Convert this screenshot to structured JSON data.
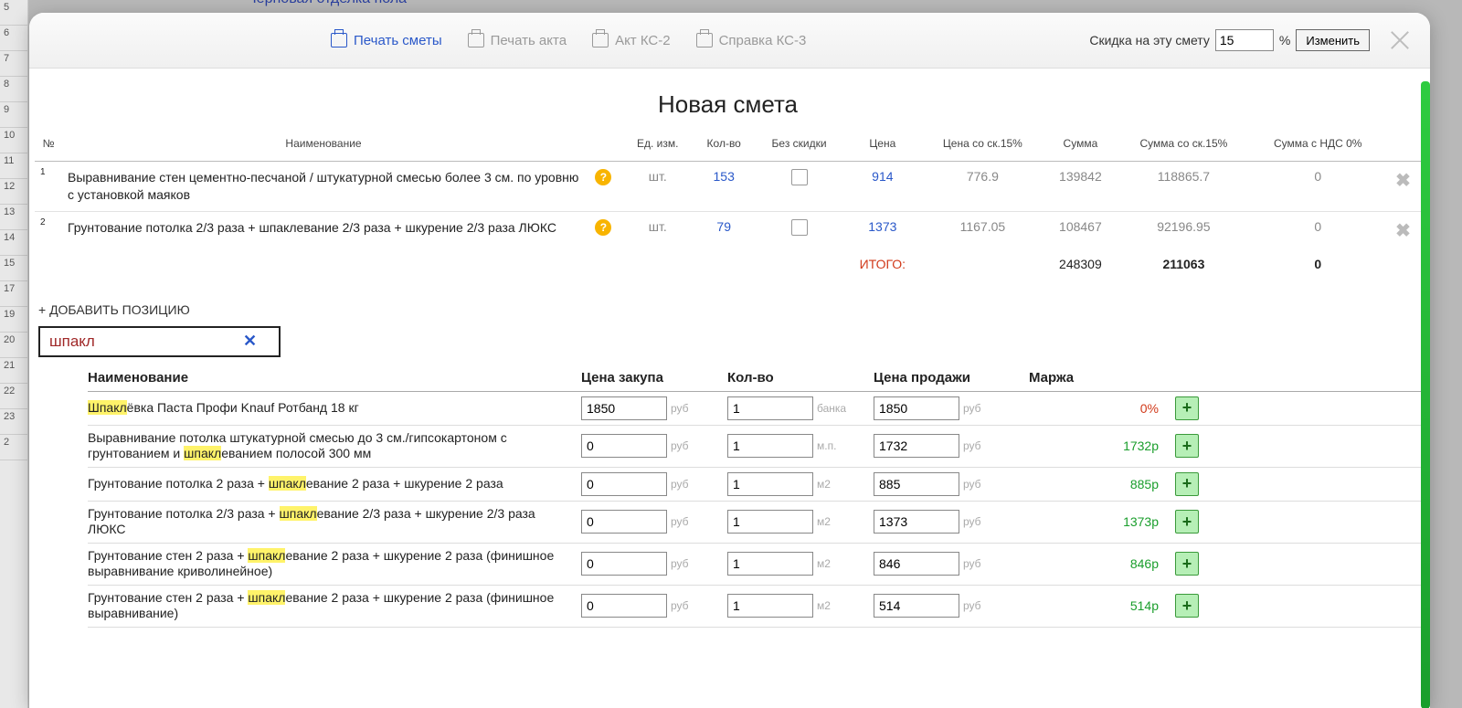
{
  "bg": {
    "header_text": "Черновая отделка пола",
    "row_numbers": [
      "5",
      "6",
      "7",
      "8",
      "9",
      "10",
      "11",
      "12",
      "13",
      "14",
      "15",
      "17",
      "19",
      "20",
      "21",
      "22",
      "23",
      "2"
    ]
  },
  "toolbar": {
    "print_estimate": "Печать сметы",
    "print_act": "Печать акта",
    "act_ks2": "Акт КС-2",
    "ref_ks3": "Справка КС-3",
    "discount_label": "Скидка на эту смету",
    "discount_value": "15",
    "discount_pct": "%",
    "apply": "Изменить"
  },
  "title": "Новая смета",
  "columns": {
    "num": "№",
    "name": "Наименование",
    "unit": "Ед. изм.",
    "qty": "Кол-во",
    "no_disc": "Без скидки",
    "price": "Цена",
    "price_disc": "Цена со ск.15%",
    "sum": "Сумма",
    "sum_disc": "Сумма со ск.15%",
    "sum_vat": "Сумма с НДС 0%"
  },
  "rows": [
    {
      "idx": "1",
      "name": "Выравнивание стен цементно-песчаной / штукатурной смесью более 3 см. по уровню с установкой маяков",
      "unit": "шт.",
      "qty": "153",
      "price": "914",
      "price_disc": "776.9",
      "sum": "139842",
      "sum_disc": "118865.7",
      "sum_vat": "0"
    },
    {
      "idx": "2",
      "name": "Грунтование потолка 2/3 раза + шпаклевание 2/3 раза + шкурение 2/3 раза ЛЮКС",
      "unit": "шт.",
      "qty": "79",
      "price": "1373",
      "price_disc": "1167.05",
      "sum": "108467",
      "sum_disc": "92196.95",
      "sum_vat": "0"
    }
  ],
  "totals": {
    "label": "ИТОГО:",
    "sum": "248309",
    "sum_disc": "211063",
    "sum_vat": "0"
  },
  "add_position": "+ ДОБАВИТЬ ПОЗИЦИЮ",
  "search": {
    "value": "шпакл",
    "clear": "✕"
  },
  "suggest_columns": {
    "name": "Наименование",
    "buy": "Цена закупа",
    "qty": "Кол-во",
    "sell": "Цена продажи",
    "margin": "Маржа"
  },
  "currency_suffix": "руб",
  "suggest": [
    {
      "pre": "",
      "hl": "Шпакл",
      "post": "ёвка Паста Профи Knauf Ротбанд 18 кг",
      "buy": "1850",
      "qty": "1",
      "unit": "банка",
      "sell": "1850",
      "margin": "0%",
      "margin_zero": true
    },
    {
      "pre": "Выравнивание потолка штукатурной смесью до 3 см./гипсокартоном с грунтованием и ",
      "hl": "шпакл",
      "post": "еванием полосой 300 мм",
      "buy": "0",
      "qty": "1",
      "unit": "м.п.",
      "sell": "1732",
      "margin": "1732р"
    },
    {
      "pre": "Грунтование потолка 2 раза + ",
      "hl": "шпакл",
      "post": "евание 2 раза + шкурение 2 раза",
      "buy": "0",
      "qty": "1",
      "unit": "м2",
      "sell": "885",
      "margin": "885р"
    },
    {
      "pre": "Грунтование потолка 2/3 раза + ",
      "hl": "шпакл",
      "post": "евание 2/3 раза + шкурение 2/3 раза ЛЮКС",
      "buy": "0",
      "qty": "1",
      "unit": "м2",
      "sell": "1373",
      "margin": "1373р"
    },
    {
      "pre": "Грунтование стен 2 раза + ",
      "hl": "шпакл",
      "post": "евание 2 раза + шкурение 2 раза (финишное выравнивание криволинейное)",
      "buy": "0",
      "qty": "1",
      "unit": "м2",
      "sell": "846",
      "margin": "846р"
    },
    {
      "pre": "Грунтование стен 2 раза + ",
      "hl": "шпакл",
      "post": "евание 2 раза + шкурение 2 раза (финишное выравнивание)",
      "buy": "0",
      "qty": "1",
      "unit": "м2",
      "sell": "514",
      "margin": "514р"
    }
  ]
}
